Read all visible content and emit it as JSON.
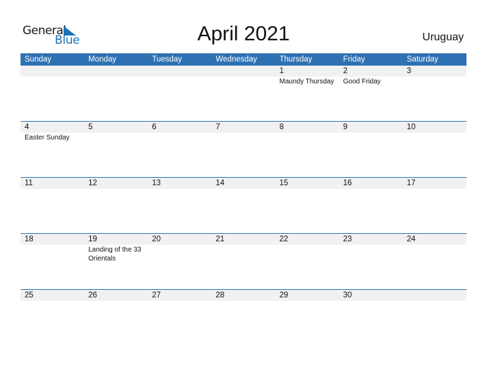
{
  "logo": {
    "word1": "General",
    "word2": "Blue"
  },
  "title": "April 2021",
  "country": "Uruguay",
  "colors": {
    "header_bg": "#2e71b3",
    "day_band": "#f1f1f1",
    "logo_blue": "#1a73b8"
  },
  "weekdays": [
    "Sunday",
    "Monday",
    "Tuesday",
    "Wednesday",
    "Thursday",
    "Friday",
    "Saturday"
  ],
  "weeks": [
    [
      {
        "day": "",
        "event": ""
      },
      {
        "day": "",
        "event": ""
      },
      {
        "day": "",
        "event": ""
      },
      {
        "day": "",
        "event": ""
      },
      {
        "day": "1",
        "event": "Maundy Thursday"
      },
      {
        "day": "2",
        "event": "Good Friday"
      },
      {
        "day": "3",
        "event": ""
      }
    ],
    [
      {
        "day": "4",
        "event": "Easter Sunday"
      },
      {
        "day": "5",
        "event": ""
      },
      {
        "day": "6",
        "event": ""
      },
      {
        "day": "7",
        "event": ""
      },
      {
        "day": "8",
        "event": ""
      },
      {
        "day": "9",
        "event": ""
      },
      {
        "day": "10",
        "event": ""
      }
    ],
    [
      {
        "day": "11",
        "event": ""
      },
      {
        "day": "12",
        "event": ""
      },
      {
        "day": "13",
        "event": ""
      },
      {
        "day": "14",
        "event": ""
      },
      {
        "day": "15",
        "event": ""
      },
      {
        "day": "16",
        "event": ""
      },
      {
        "day": "17",
        "event": ""
      }
    ],
    [
      {
        "day": "18",
        "event": ""
      },
      {
        "day": "19",
        "event": "Landing of the 33 Orientals"
      },
      {
        "day": "20",
        "event": ""
      },
      {
        "day": "21",
        "event": ""
      },
      {
        "day": "22",
        "event": ""
      },
      {
        "day": "23",
        "event": ""
      },
      {
        "day": "24",
        "event": ""
      }
    ],
    [
      {
        "day": "25",
        "event": ""
      },
      {
        "day": "26",
        "event": ""
      },
      {
        "day": "27",
        "event": ""
      },
      {
        "day": "28",
        "event": ""
      },
      {
        "day": "29",
        "event": ""
      },
      {
        "day": "30",
        "event": ""
      },
      {
        "day": "",
        "event": ""
      }
    ]
  ]
}
